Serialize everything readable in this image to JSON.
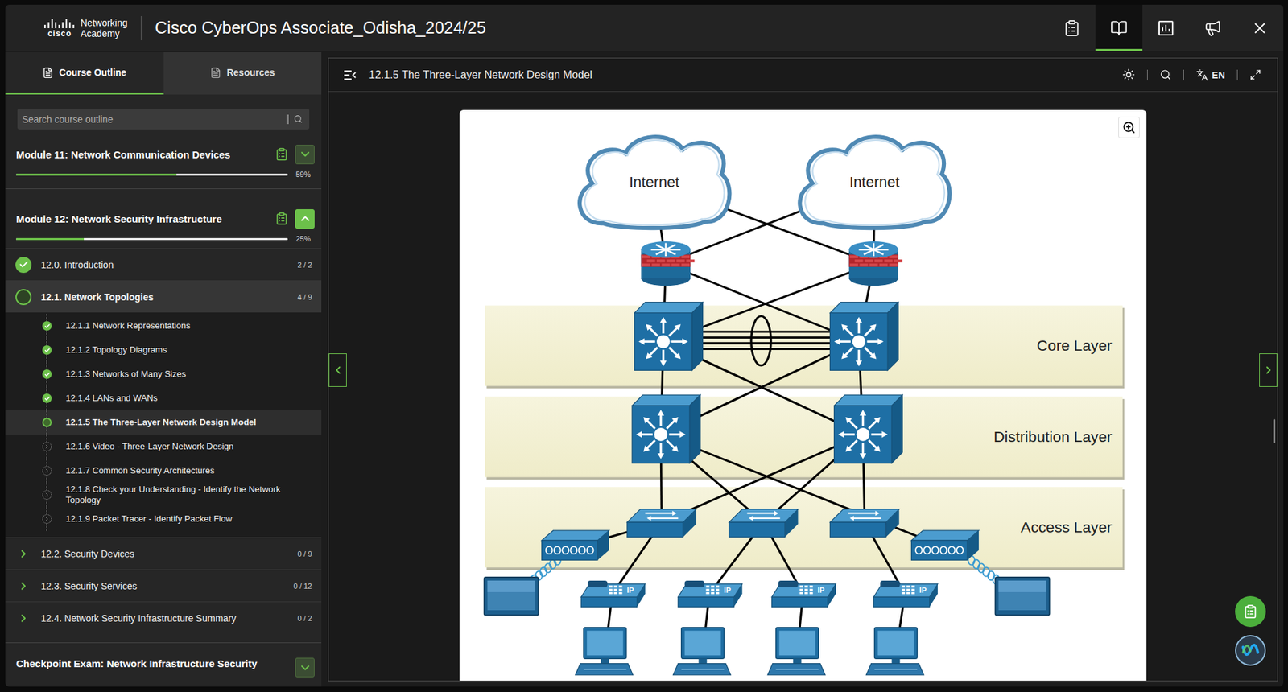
{
  "header": {
    "logo": {
      "wordmark": "cisco",
      "lines": [
        "Networking",
        "Academy"
      ]
    },
    "title": "Cisco CyberOps Associate_Odisha_2024/25",
    "tools": [
      {
        "selected": false
      },
      {
        "selected": true
      },
      {
        "selected": false
      },
      {
        "selected": false
      },
      {
        "selected": false
      }
    ]
  },
  "sidebar": {
    "tabs": [
      {
        "label": "Course Outline",
        "selected": true
      },
      {
        "label": "Resources",
        "selected": false
      }
    ],
    "search": {
      "placeholder": "Search course outline"
    },
    "modules": [
      {
        "title": "Module 11: Network Communication Devices",
        "expanded": false,
        "level": 0.59,
        "percent": "59%",
        "sections": []
      },
      {
        "title": "Module 12: Network Security Infrastructure",
        "expanded": true,
        "level": 0.25,
        "percent": "25%",
        "sections": [
          {
            "title": "12.0. Introduction",
            "count": "2 / 2",
            "kind": "check",
            "selected": false,
            "expanded": false,
            "topics": []
          },
          {
            "title": "12.1. Network Topologies",
            "count": "4 / 9",
            "kind": "ring",
            "selected": true,
            "expanded": true,
            "topics": [
              {
                "title": "12.1.1 Network Representations",
                "kind": "done",
                "selected": false
              },
              {
                "title": "12.1.2 Topology Diagrams",
                "kind": "done",
                "selected": false
              },
              {
                "title": "12.1.3 Networks of Many Sizes",
                "kind": "done",
                "selected": false
              },
              {
                "title": "12.1.4 LANs and WANs",
                "kind": "done",
                "selected": false
              },
              {
                "title": "12.1.5 The Three-Layer Network Design Model",
                "kind": "current",
                "selected": true
              },
              {
                "title": "12.1.6 Video - Three-Layer Network Design",
                "kind": "todo",
                "selected": false
              },
              {
                "title": "12.1.7 Common Security Architectures",
                "kind": "todo",
                "selected": false
              },
              {
                "title": "12.1.8 Check your Understanding - Identify the Network Topology",
                "kind": "todo",
                "selected": false
              },
              {
                "title": "12.1.9 Packet Tracer - Identify Packet Flow",
                "kind": "todo",
                "selected": false
              }
            ]
          },
          {
            "title": "12.2. Security Devices",
            "count": "0 / 9",
            "kind": "chevron",
            "selected": false,
            "expanded": false,
            "topics": []
          },
          {
            "title": "12.3. Security Services",
            "count": "0 / 12",
            "kind": "chevron",
            "selected": false,
            "expanded": false,
            "topics": []
          },
          {
            "title": "12.4. Network Security Infrastructure Summary",
            "count": "0 / 2",
            "kind": "chevron",
            "selected": false,
            "expanded": false,
            "topics": []
          }
        ]
      }
    ],
    "exam": {
      "title": "Checkpoint Exam: Network Infrastructure Security",
      "expanded": false
    }
  },
  "content": {
    "title": "12.1.5 The Three-Layer Network Design Model",
    "language": "EN",
    "diagram": {
      "clouds": [
        {
          "label": "Internet"
        },
        {
          "label": "Internet"
        }
      ],
      "layers": [
        {
          "label": "Core Layer"
        },
        {
          "label": "Distribution Layer"
        },
        {
          "label": "Access Layer"
        }
      ],
      "phones": [
        {
          "label": "IP"
        },
        {
          "label": "IP"
        },
        {
          "label": "IP"
        },
        {
          "label": "IP"
        }
      ]
    }
  }
}
